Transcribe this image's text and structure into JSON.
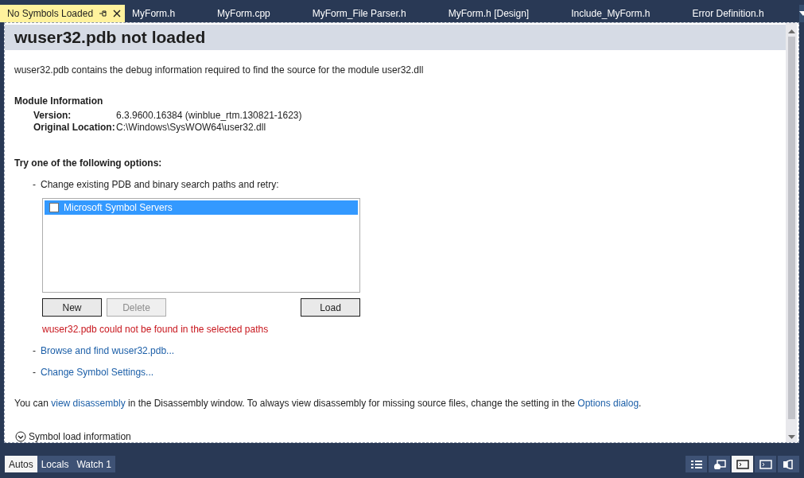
{
  "tabs": [
    {
      "label": "No Symbols Loaded",
      "selected": true,
      "pinned": true
    },
    {
      "label": "MyForm.h",
      "selected": false,
      "pinned": false
    },
    {
      "label": "MyForm.cpp",
      "selected": false,
      "pinned": false
    },
    {
      "label": "MyForm_File Parser.h",
      "selected": false,
      "pinned": false
    },
    {
      "label": "MyForm.h [Design]",
      "selected": false,
      "pinned": false
    },
    {
      "label": "Include_MyForm.h",
      "selected": false,
      "pinned": false
    },
    {
      "label": "Error Definition.h",
      "selected": false,
      "pinned": false
    }
  ],
  "document": {
    "title": "wuser32.pdb not loaded",
    "intro": "wuser32.pdb contains the debug information required to find the source for the module user32.dll",
    "module_heading": "Module Information",
    "module_fields": [
      {
        "label": "Version:",
        "value": "6.3.9600.16384 (winblue_rtm.130821-1623)"
      },
      {
        "label": "Original Location:",
        "value": "C:\\Windows\\SysWOW64\\user32.dll"
      }
    ],
    "options_heading": "Try one of the following options:",
    "search_paths": {
      "bullet": "-",
      "label": "Change existing PDB and binary search paths and retry:"
    },
    "paths": [
      {
        "label": "Microsoft Symbol Servers",
        "checked": false,
        "selected": true
      }
    ],
    "buttons": [
      {
        "label": "New",
        "disabled": false,
        "kind": "left"
      },
      {
        "label": "Delete",
        "disabled": true,
        "kind": "left"
      },
      {
        "label": "Load",
        "disabled": false,
        "kind": "right"
      }
    ],
    "error": "wuser32.pdb could not be found in the selected paths",
    "links": [
      {
        "bullet": "-",
        "label": "Browse and find wuser32.pdb..."
      },
      {
        "bullet": "-",
        "label": "Change Symbol Settings..."
      }
    ],
    "footer": [
      {
        "text": "You can ",
        "link": false
      },
      {
        "text": "view disassembly",
        "link": true
      },
      {
        "text": " in the Disassembly window. To always view disassembly for missing source files, change the setting in the ",
        "link": false
      },
      {
        "text": "Options dialog",
        "link": true
      },
      {
        "text": ".",
        "link": false
      }
    ],
    "symbol_load_info": {
      "label": "Symbol load information",
      "expanded": false
    }
  },
  "tool_tabs": [
    {
      "label": "Autos",
      "selected": true
    },
    {
      "label": "Locals",
      "selected": false
    },
    {
      "label": "Watch 1",
      "selected": false
    }
  ],
  "tool_icons": [
    {
      "selected": false
    },
    {
      "selected": false
    },
    {
      "selected": true
    },
    {
      "selected": false
    },
    {
      "selected": false
    }
  ]
}
